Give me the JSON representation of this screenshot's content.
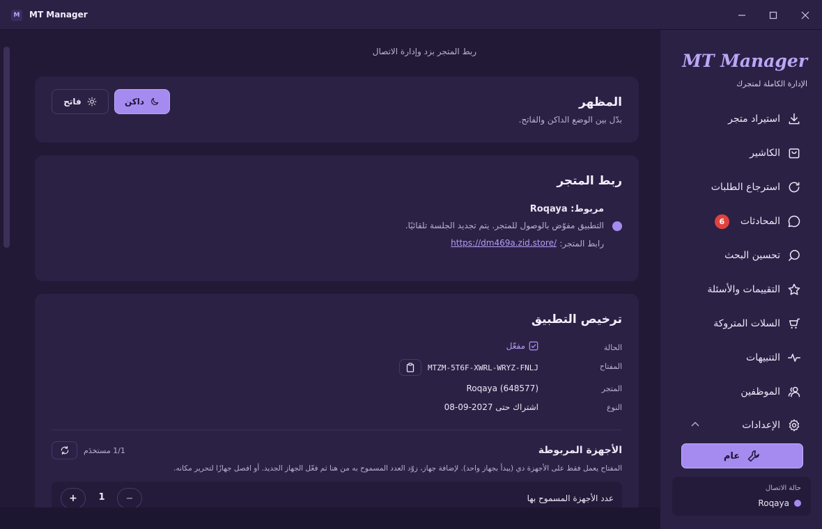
{
  "window": {
    "title": "MT Manager",
    "logo_letter": "M"
  },
  "page": {
    "subtitle": "ربط المتجر بزد وإدارة الاتصال"
  },
  "appearance": {
    "title": "المظهر",
    "description": "بدّل بين الوضع الداكن والفاتح.",
    "dark_label": "داكن",
    "light_label": "فاتح",
    "selected": "dark"
  },
  "store_link": {
    "title": "ربط المتجر",
    "connected_label": "مربوط: Roqaya",
    "description": "التطبيق مفوّض بالوصول للمتجر. يتم تجديد الجلسة تلقائيًا.",
    "url_label": "رابط المتجر:",
    "url": "https://dm469a.zid.store/"
  },
  "license": {
    "title": "ترخيص التطبيق",
    "rows": [
      {
        "label": "الحالة",
        "value": "مفعّل"
      },
      {
        "label": "المفتاح",
        "value": "MTZM-5T6F-XWRL-WRYZ-FNLJ"
      },
      {
        "label": "المتجر",
        "value": "(Roqaya (648577"
      },
      {
        "label": "النوع",
        "value": "اشتراك حتى 2027-09-08"
      }
    ],
    "devices": {
      "title": "الأجهزة المربوطة",
      "users": "1/1 مستخدَم",
      "description": "المفتاح يعمل فقط على الأجهزة دي (يبدأ بجهاز واحد). لإضافة جهاز، زوّد العدد المسموح به من هنا ثم فعّل الجهاز الجديد. أو افصل جهازًا لتحرير مكانه.",
      "allowed_label": "عدد الأجهزة المسموح بها",
      "allowed_count": "1",
      "minus": "−",
      "plus": "+"
    }
  },
  "sidebar": {
    "brand": "MT Manager",
    "brand_sub": "الإدارة الكاملة لمتجرك",
    "items": [
      {
        "label": "استيراد متجر",
        "icon": "download-icon"
      },
      {
        "label": "الكاشير",
        "icon": "bag-icon"
      },
      {
        "label": "استرجاع الطلبات",
        "icon": "refresh-icon"
      },
      {
        "label": "المحادثات",
        "icon": "chat-icon",
        "badge": "6"
      },
      {
        "label": "تحسين البحث",
        "icon": "search-icon"
      },
      {
        "label": "التقييمات والأسئلة",
        "icon": "star-icon"
      },
      {
        "label": "السلات المتروكة",
        "icon": "cart-icon"
      },
      {
        "label": "التنبيهات",
        "icon": "activity-icon"
      },
      {
        "label": "الموظفين",
        "icon": "users-icon"
      },
      {
        "label": "الإعدادات",
        "icon": "gear-icon"
      }
    ],
    "active_sub": "عام",
    "connection": {
      "title": "حالة الاتصال",
      "store": "Roqaya"
    }
  },
  "colors": {
    "accent": "#a58bf0",
    "background": "#211935",
    "card": "#2b2145",
    "badge": "#e0433f"
  }
}
